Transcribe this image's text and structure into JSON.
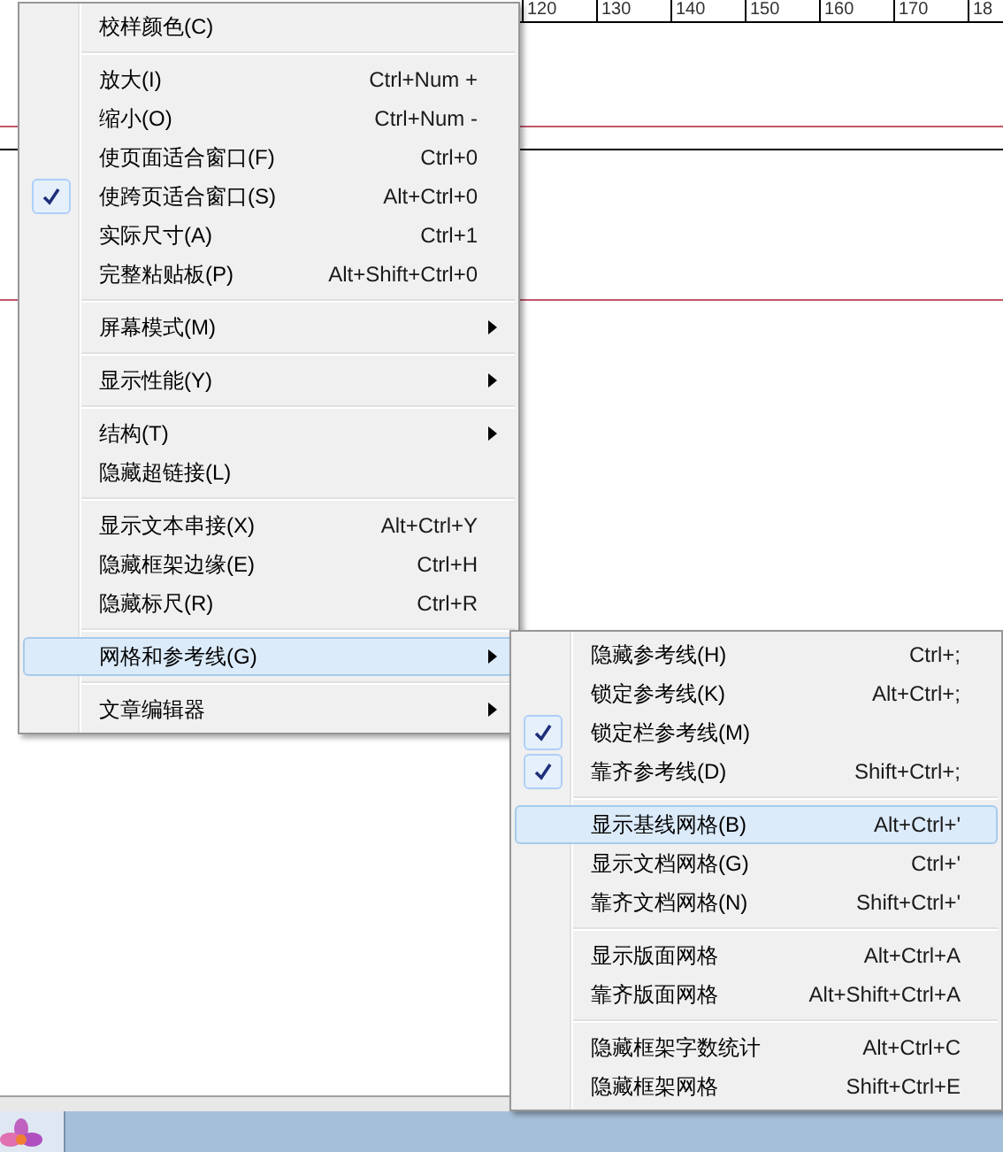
{
  "ruler": {
    "labels": [
      "120",
      "130",
      "140",
      "150",
      "160",
      "170",
      "18"
    ]
  },
  "view_menu": {
    "sections": [
      {
        "items": [
          {
            "label": "校样颜色(C)",
            "checked": false,
            "submenu": false,
            "selected": false
          }
        ]
      },
      {
        "items": [
          {
            "label": "放大(I)",
            "shortcut": "Ctrl+Num +",
            "checked": false,
            "submenu": false,
            "selected": false
          },
          {
            "label": "缩小(O)",
            "shortcut": "Ctrl+Num -",
            "checked": false,
            "submenu": false,
            "selected": false
          },
          {
            "label": "使页面适合窗口(F)",
            "shortcut": "Ctrl+0",
            "checked": false,
            "submenu": false,
            "selected": false
          },
          {
            "label": "使跨页适合窗口(S)",
            "shortcut": "Alt+Ctrl+0",
            "checked": true,
            "submenu": false,
            "selected": false
          },
          {
            "label": "实际尺寸(A)",
            "shortcut": "Ctrl+1",
            "checked": false,
            "submenu": false,
            "selected": false
          },
          {
            "label": "完整粘贴板(P)",
            "shortcut": "Alt+Shift+Ctrl+0",
            "checked": false,
            "submenu": false,
            "selected": false
          }
        ]
      },
      {
        "items": [
          {
            "label": "屏幕模式(M)",
            "checked": false,
            "submenu": true,
            "selected": false
          }
        ]
      },
      {
        "items": [
          {
            "label": "显示性能(Y)",
            "checked": false,
            "submenu": true,
            "selected": false
          }
        ]
      },
      {
        "items": [
          {
            "label": "结构(T)",
            "checked": false,
            "submenu": true,
            "selected": false
          },
          {
            "label": "隐藏超链接(L)",
            "checked": false,
            "submenu": false,
            "selected": false
          }
        ]
      },
      {
        "items": [
          {
            "label": "显示文本串接(X)",
            "shortcut": "Alt+Ctrl+Y",
            "checked": false,
            "submenu": false,
            "selected": false
          },
          {
            "label": "隐藏框架边缘(E)",
            "shortcut": "Ctrl+H",
            "checked": false,
            "submenu": false,
            "selected": false
          },
          {
            "label": "隐藏标尺(R)",
            "shortcut": "Ctrl+R",
            "checked": false,
            "submenu": false,
            "selected": false
          }
        ]
      },
      {
        "items": [
          {
            "label": "网格和参考线(G)",
            "checked": false,
            "submenu": true,
            "selected": true
          }
        ]
      },
      {
        "items": [
          {
            "label": "文章编辑器",
            "checked": false,
            "submenu": true,
            "selected": false
          }
        ]
      }
    ]
  },
  "grids_submenu": {
    "sections": [
      {
        "items": [
          {
            "label": "隐藏参考线(H)",
            "shortcut": "Ctrl+;",
            "checked": false,
            "submenu": false,
            "selected": false
          },
          {
            "label": "锁定参考线(K)",
            "shortcut": "Alt+Ctrl+;",
            "checked": false,
            "submenu": false,
            "selected": false
          },
          {
            "label": "锁定栏参考线(M)",
            "checked": true,
            "submenu": false,
            "selected": false
          },
          {
            "label": "靠齐参考线(D)",
            "shortcut": "Shift+Ctrl+;",
            "checked": true,
            "submenu": false,
            "selected": false
          }
        ]
      },
      {
        "items": [
          {
            "label": "显示基线网格(B)",
            "shortcut": "Alt+Ctrl+'",
            "checked": false,
            "submenu": false,
            "selected": true
          },
          {
            "label": "显示文档网格(G)",
            "shortcut": "Ctrl+'",
            "checked": false,
            "submenu": false,
            "selected": false
          },
          {
            "label": "靠齐文档网格(N)",
            "shortcut": "Shift+Ctrl+'",
            "checked": false,
            "submenu": false,
            "selected": false
          }
        ]
      },
      {
        "items": [
          {
            "label": "显示版面网格",
            "shortcut": "Alt+Ctrl+A",
            "checked": false,
            "submenu": false,
            "selected": false
          },
          {
            "label": "靠齐版面网格",
            "shortcut": "Alt+Shift+Ctrl+A",
            "checked": false,
            "submenu": false,
            "selected": false
          }
        ]
      },
      {
        "items": [
          {
            "label": "隐藏框架字数统计",
            "shortcut": "Alt+Ctrl+C",
            "checked": false,
            "submenu": false,
            "selected": false
          },
          {
            "label": "隐藏框架网格",
            "shortcut": "Shift+Ctrl+E",
            "checked": false,
            "submenu": false,
            "selected": false
          }
        ]
      }
    ]
  }
}
